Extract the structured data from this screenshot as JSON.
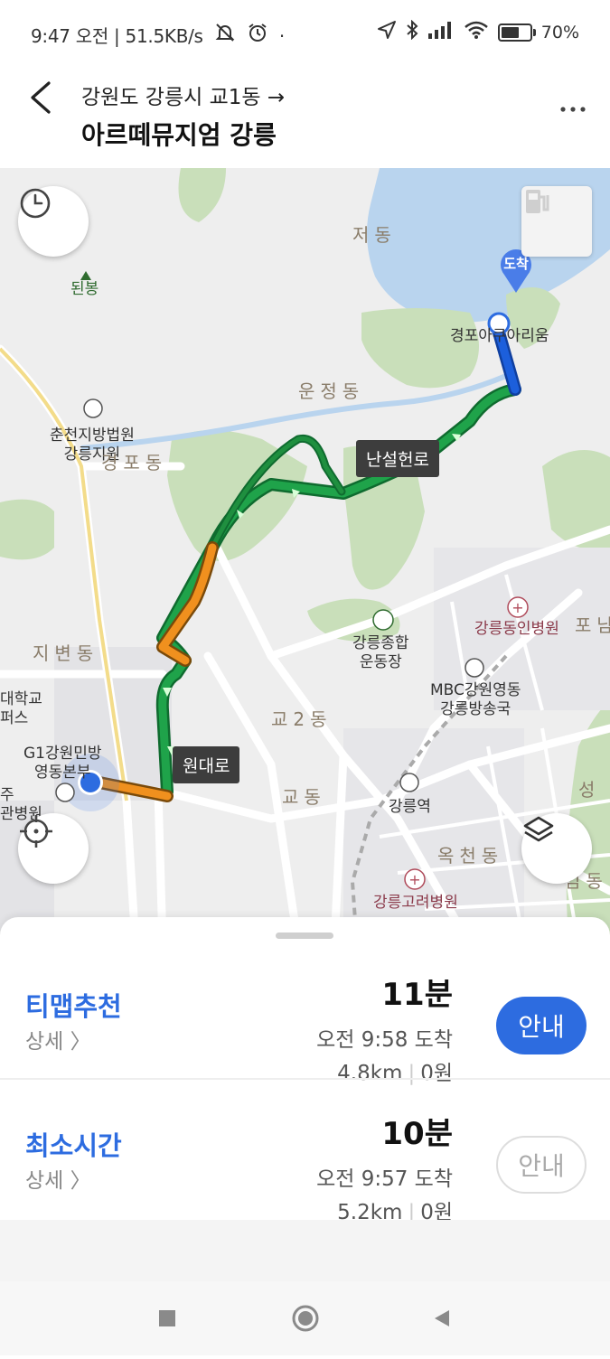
{
  "status_bar": {
    "time": "9:47",
    "ampm": "오전",
    "network_speed": "| 51.5KB/s",
    "battery": "70%",
    "battery_level": 0.7
  },
  "header": {
    "origin": "강원도 강릉시 교1동 →",
    "destination": "아르떼뮤지엄 강릉"
  },
  "map": {
    "destination_badge": "도착",
    "destination_poi": "경포아쿠아리움",
    "labels": {
      "jeo_dong": "저동",
      "doenbong": "된봉",
      "unjeong_dong": "운정동",
      "court": "춘천지방법원\n강릉지원",
      "gangpo_dong": "경포동",
      "gangneung_stadium": "강릉종합\n운동장",
      "dongin_hospital": "강릉동인병원",
      "po_nam": "포남",
      "jibyeon_dong": "지변동",
      "univ_campus": "대학교\n퍼스",
      "mbc": "MBC강원영동\n강릉방송국",
      "gyo2_dong": "교2동",
      "g1": "G1강원민방\n영동본부",
      "clinic": "주\n관병원",
      "gyo_dong": "교동",
      "gangneung_station": "강릉역",
      "seong": "성",
      "okcheon_dong": "옥천동",
      "gimmun": "임동",
      "goryeo_hospital": "강릉고려병원"
    },
    "road_tags": {
      "nanseolheon": "난설헌로",
      "wondae": "원대로"
    }
  },
  "routes": [
    {
      "name": "티맵추천",
      "detail": "상세 〉",
      "duration": "11분",
      "arrival": "오전 9:58 도착",
      "distance": "4.8km",
      "toll": "0원",
      "button": "안내"
    },
    {
      "name": "최소시간",
      "detail": "상세 〉",
      "duration": "10분",
      "arrival": "오전 9:57 도착",
      "distance": "5.2km",
      "toll": "0원",
      "button": "안내"
    }
  ],
  "colors": {
    "accent": "#2d6ce0",
    "route_green": "#1fa34a",
    "route_orange": "#f0901e",
    "route_blue": "#1c5fdc",
    "water": "#b9d4ee",
    "park": "#c9dfba"
  }
}
